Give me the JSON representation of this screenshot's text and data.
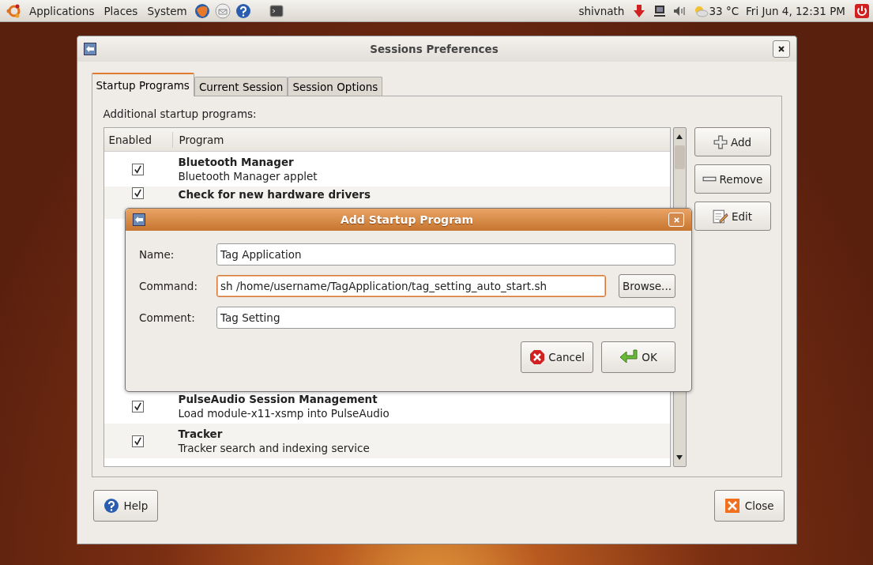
{
  "top_panel": {
    "menus": [
      "Applications",
      "Places",
      "System"
    ],
    "user": "shivnath",
    "weather": "33 °C",
    "clock": "Fri Jun  4, 12:31 PM"
  },
  "window": {
    "title": "Sessions Preferences",
    "tabs": [
      {
        "label": "Startup Programs",
        "selected": true
      },
      {
        "label": "Current Session",
        "selected": false
      },
      {
        "label": "Session Options",
        "selected": false
      }
    ],
    "section_label": "Additional startup programs:",
    "table": {
      "columns": [
        "Enabled",
        "Program"
      ],
      "rows": [
        {
          "enabled": true,
          "name": "Bluetooth Manager",
          "description": "Bluetooth Manager applet",
          "hidden_below": false
        },
        {
          "enabled": true,
          "name": "Check for new hardware drivers",
          "hidden_below": true
        },
        {
          "enabled": true,
          "name": "PulseAudio Session Management",
          "description": "Load module-x11-xsmp into PulseAudio",
          "hidden_below": false
        },
        {
          "enabled": true,
          "name": "Tracker",
          "description": "Tracker search and indexing service",
          "hidden_below": false
        }
      ]
    },
    "side_buttons": [
      {
        "kind": "add",
        "label": "Add"
      },
      {
        "kind": "remove",
        "label": "Remove"
      },
      {
        "kind": "edit",
        "label": "Edit"
      }
    ],
    "help_button": "Help",
    "close_button": "Close"
  },
  "dialog": {
    "title": "Add Startup Program",
    "fields": [
      {
        "label": "Name:",
        "value": "Tag Application",
        "focused": false
      },
      {
        "label": "Command:",
        "value": "sh /home/username/TagApplication/tag_setting_auto_start.sh",
        "focused": true,
        "browse": "Browse..."
      },
      {
        "label": "Comment:",
        "value": "Tag Setting",
        "focused": false
      }
    ],
    "cancel": "Cancel",
    "ok": "OK"
  }
}
